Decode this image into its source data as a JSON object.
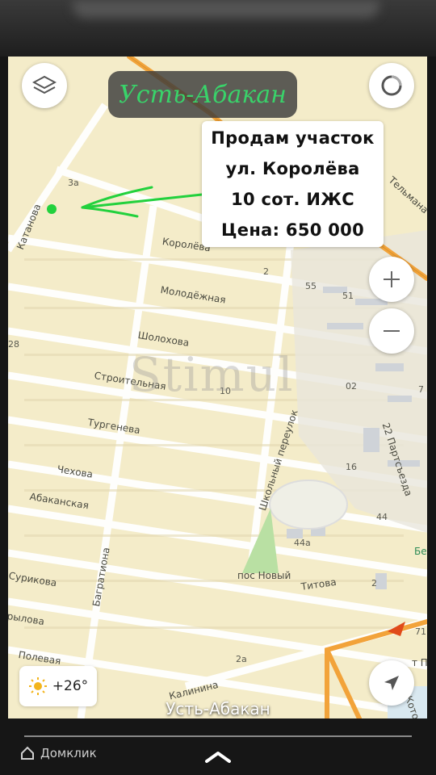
{
  "title": "Усть-Абакан",
  "ad": {
    "line1": "Продам участок",
    "line2": "ул. Королёва",
    "line3": "10 сот. ИЖС",
    "line4": "Цена: 650 000"
  },
  "streets": {
    "katanova": "Катанова",
    "koroleva": "Королёва",
    "molodezhnaya": "Молодёжная",
    "sholokhova": "Шолохова",
    "stroitelnaya": "Строительная",
    "turgeneva": "Тургенева",
    "chekhova": "Чехова",
    "abakanskaya": "Абаканская",
    "bagrationa": "Багратиона",
    "surikova": "Сурикова",
    "krylova": "рылова",
    "polevaya": "Полевая",
    "kalinina": "Калинина",
    "shkolny": "Школьный переулок",
    "partsezda": "22 Партсъезда",
    "titova": "Титова",
    "telmana": "Тельмана",
    "pos_novy": "пос Новый",
    "bel": "Бел",
    "t_po": "т По",
    "koto": "Кото"
  },
  "house_numbers": [
    "3а",
    "2",
    "55",
    "51",
    "28",
    "10",
    "02",
    "7",
    "16",
    "44",
    "44а",
    "2",
    "2а",
    "71"
  ],
  "watermark": "Stimul",
  "weather": {
    "temp": "+26°",
    "icon": "sun-icon"
  },
  "city_label": "Усть-Абакан",
  "branding": "Домклик",
  "colors": {
    "map_bg": "#f4ecc9",
    "road_orange": "#f2a33a",
    "title_green": "#39d36a",
    "marker_green": "#22d13d"
  }
}
